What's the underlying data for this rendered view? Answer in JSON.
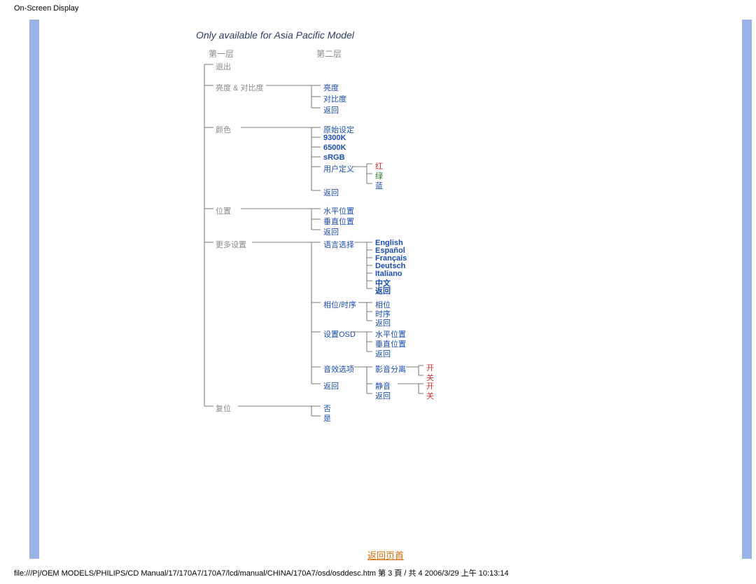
{
  "header": "On-Screen Display",
  "footer": "file:///P|/OEM MODELS/PHILIPS/CD Manual/17/170A7/170A7/lcd/manual/CHINA/170A7/osd/osddesc.htm 第 3 頁 / 共 4 2006/3/29 上午 10:13:14",
  "title": "Only available for Asia Pacific Model",
  "levels": {
    "first": "第一层",
    "second": "第二层"
  },
  "menu": {
    "exit": "退出",
    "brightness_contrast": "亮度 & 对比度",
    "brightness": "亮度",
    "contrast": "对比度",
    "back": "返回",
    "color": "颜色",
    "original": "原始设定",
    "k9300": "9300K",
    "k6500": "6500K",
    "srgb": "sRGB",
    "user_def": "用户定义",
    "r": "红",
    "g": "绿",
    "b": "蓝",
    "position": "位置",
    "h_pos": "水平位置",
    "v_pos": "垂直位置",
    "more_settings": "更多设置",
    "language": "语言选择",
    "english": "English",
    "espanol": "Español",
    "francais": "Français",
    "deutsch": "Deutsch",
    "italiano": "Italiano",
    "chinese": "中文",
    "phase_clock": "相位/时序",
    "phase": "相位",
    "clock": "时序",
    "setup_osd": "设置OSD",
    "audio_opts": "音效选项",
    "surround": "影音分离",
    "mute": "静音",
    "on": "开",
    "off": "关",
    "reset": "复位",
    "no": "否",
    "yes": "是"
  },
  "return_top": "返回页首"
}
